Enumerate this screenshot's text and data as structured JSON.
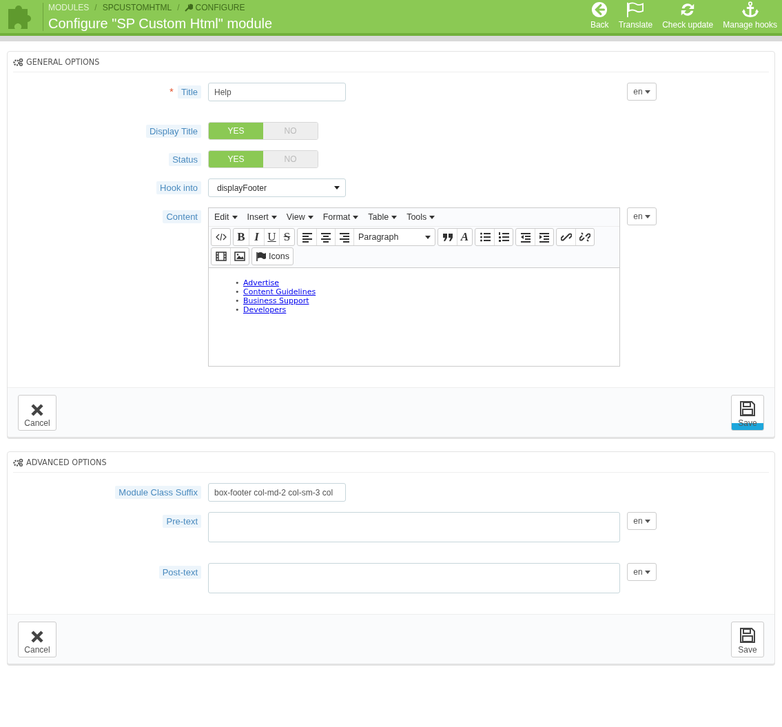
{
  "header": {
    "separator": "/",
    "breadcrumbs": [
      {
        "label": "MODULES",
        "kind": "link"
      },
      {
        "label": "SPCUSTOMHTML",
        "kind": "plain"
      },
      {
        "label": "CONFIGURE",
        "kind": "wrench"
      }
    ],
    "title": "Configure \"SP Custom Html\" module",
    "toolbar": [
      {
        "label": "Back",
        "kind": "back"
      },
      {
        "label": "Translate",
        "kind": "flag"
      },
      {
        "label": "Check update",
        "kind": "refresh"
      },
      {
        "label": "Manage hooks",
        "kind": "anchor"
      }
    ]
  },
  "panels": [
    {
      "title": "GENERAL OPTIONS",
      "fields": [
        {
          "kind": "text",
          "label": "Title",
          "required_mark": "*",
          "value": "Help",
          "lang": "en"
        },
        {
          "kind": "switch",
          "label": "Display Title",
          "options": [
            {
              "label": "YES",
              "selected": true
            },
            {
              "label": "NO",
              "selected": false
            }
          ]
        },
        {
          "kind": "switch",
          "label": "Status",
          "options": [
            {
              "label": "YES",
              "selected": true
            },
            {
              "label": "NO",
              "selected": false
            }
          ]
        },
        {
          "kind": "select",
          "label": "Hook into",
          "value": "displayFooter"
        },
        {
          "kind": "editor",
          "label": "Content",
          "lang": "en",
          "menus": [
            "Edit",
            "Insert",
            "View",
            "Format",
            "Table",
            "Tools"
          ],
          "toolbar": [
            [
              [
                {
                  "kind": "code"
                }
              ],
              [
                {
                  "kind": "char",
                  "label": "B"
                },
                {
                  "kind": "char",
                  "label": "I"
                },
                {
                  "kind": "char",
                  "label": "U"
                },
                {
                  "kind": "char",
                  "label": "S"
                }
              ],
              [
                {
                  "kind": "align-left"
                },
                {
                  "kind": "align-center"
                },
                {
                  "kind": "align-right"
                },
                {
                  "kind": "select",
                  "label": "Paragraph"
                }
              ],
              [
                {
                  "kind": "quote"
                },
                {
                  "kind": "char",
                  "label": "A"
                }
              ],
              [
                {
                  "kind": "bullets"
                },
                {
                  "kind": "numbers"
                }
              ],
              [
                {
                  "kind": "outdent"
                },
                {
                  "kind": "indent"
                }
              ],
              [
                {
                  "kind": "link"
                },
                {
                  "kind": "unlink"
                }
              ]
            ],
            [
              [
                {
                  "kind": "video"
                },
                {
                  "kind": "image"
                }
              ],
              [
                {
                  "kind": "flag",
                  "label": "Icons"
                }
              ]
            ]
          ],
          "links": [
            {
              "bullet": "•",
              "text": "Advertise"
            },
            {
              "bullet": "•",
              "text": "Content Guidelines"
            },
            {
              "bullet": "•",
              "text": "Business Support"
            },
            {
              "bullet": "•",
              "text": "Developers"
            }
          ]
        }
      ],
      "footer": {
        "cancel": "Cancel",
        "save": "Save",
        "save_active": true
      }
    },
    {
      "title": "ADVANCED OPTIONS",
      "fields": [
        {
          "kind": "text",
          "label": "Module Class Suffix",
          "value": "box-footer col-md-2 col-sm-3 col"
        },
        {
          "kind": "textarea",
          "label": "Pre-text",
          "lang": "en"
        },
        {
          "kind": "textarea",
          "label": "Post-text",
          "lang": "en"
        }
      ],
      "footer": {
        "cancel": "Cancel",
        "save": "Save",
        "save_active": false
      }
    }
  ]
}
